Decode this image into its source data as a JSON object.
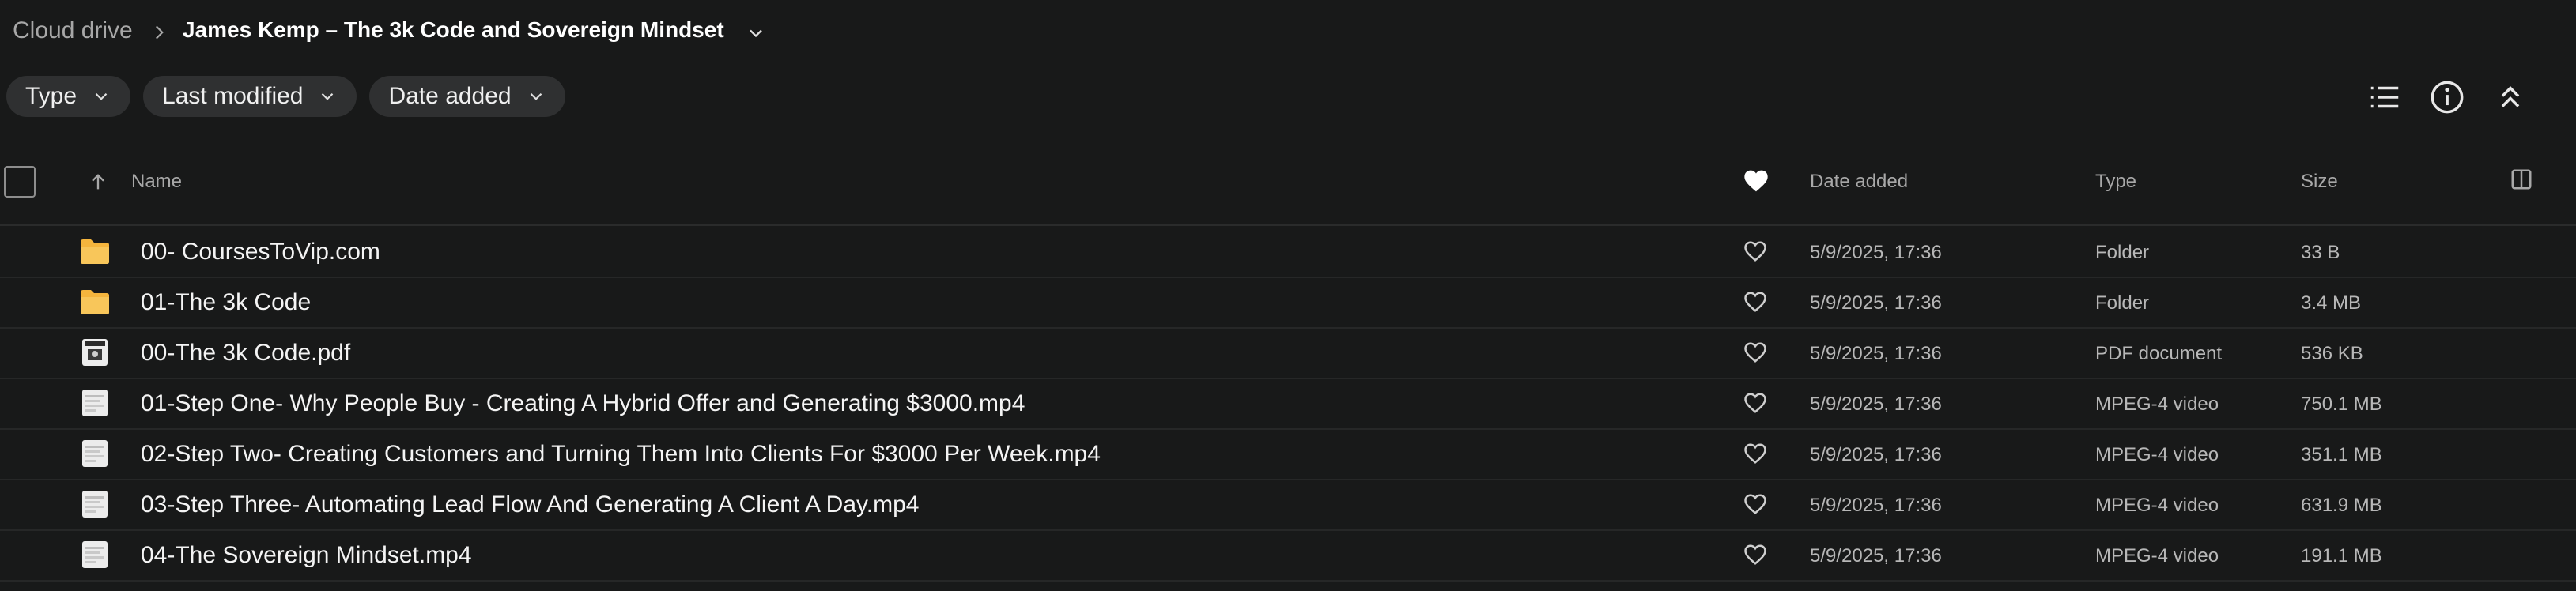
{
  "breadcrumb": {
    "root": "Cloud drive",
    "current": "James Kemp – The 3k Code and Sovereign Mindset"
  },
  "filters": [
    {
      "label": "Type"
    },
    {
      "label": "Last modified"
    },
    {
      "label": "Date added"
    }
  ],
  "table": {
    "headers": {
      "name": "Name",
      "date_added": "Date added",
      "type": "Type",
      "size": "Size"
    },
    "rows": [
      {
        "name": "00- CoursesToVip.com",
        "date": "5/9/2025, 17:36",
        "type": "Folder",
        "size": "33 B",
        "icon": "folder-icon"
      },
      {
        "name": "01-The 3k Code",
        "date": "5/9/2025, 17:36",
        "type": "Folder",
        "size": "3.4 MB",
        "icon": "folder-icon"
      },
      {
        "name": "00-The 3k Code.pdf",
        "date": "5/9/2025, 17:36",
        "type": "PDF document",
        "size": "536 KB",
        "icon": "pdf-file-icon"
      },
      {
        "name": "01-Step One- Why People Buy - Creating A Hybrid Offer and Generating $3000.mp4",
        "date": "5/9/2025, 17:36",
        "type": "MPEG-4 video",
        "size": "750.1 MB",
        "icon": "video-file-icon"
      },
      {
        "name": "02-Step Two- Creating Customers and Turning Them Into Clients For $3000 Per Week.mp4",
        "date": "5/9/2025, 17:36",
        "type": "MPEG-4 video",
        "size": "351.1 MB",
        "icon": "video-file-icon"
      },
      {
        "name": "03-Step Three- Automating Lead Flow And Generating A Client A Day.mp4",
        "date": "5/9/2025, 17:36",
        "type": "MPEG-4 video",
        "size": "631.9 MB",
        "icon": "video-file-icon"
      },
      {
        "name": "04-The Sovereign Mindset.mp4",
        "date": "5/9/2025, 17:36",
        "type": "MPEG-4 video",
        "size": "191.1 MB",
        "icon": "video-file-icon"
      }
    ]
  },
  "colors": {
    "background": "#181919",
    "chip": "#2f3031",
    "folder": "#f5b53d"
  }
}
